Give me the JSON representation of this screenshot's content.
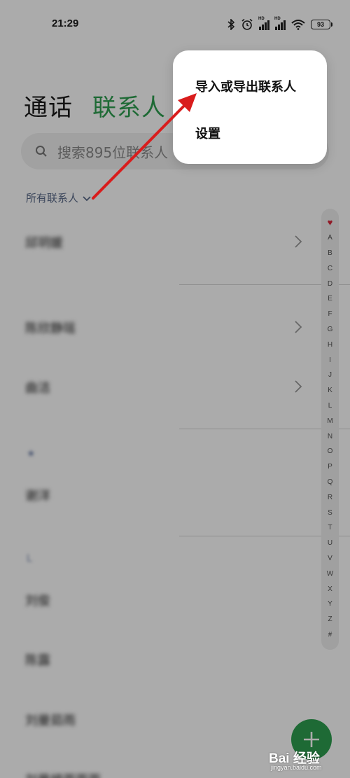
{
  "status_bar": {
    "time": "21:29",
    "icons": [
      "bluetooth-icon",
      "alarm-icon",
      "signal-hd-icon",
      "signal-hd-icon",
      "wifi-icon"
    ],
    "battery": "93"
  },
  "header": {
    "tab_calls": "通话",
    "tab_contacts": "联系人",
    "active_tab_color": "#2e9e4f"
  },
  "search": {
    "placeholder": "搜索895位联系人"
  },
  "group_label": "所有联系人",
  "contacts": {
    "rows": [
      "邱玥媛",
      "陈欣静瑶",
      "曲洁",
      "谢洋",
      "刘俊",
      "陈露",
      "刘曼茹雨",
      "刘曼婷雨雨雨"
    ],
    "sections": [
      "★",
      "L"
    ]
  },
  "index_bar": {
    "favorite_symbol": "♥",
    "letters": [
      "A",
      "B",
      "C",
      "D",
      "E",
      "F",
      "G",
      "H",
      "I",
      "J",
      "K",
      "L",
      "M",
      "N",
      "O",
      "P",
      "Q",
      "R",
      "S",
      "T",
      "U",
      "V",
      "W",
      "X",
      "Y",
      "Z",
      "#"
    ]
  },
  "menu": {
    "import_export": "导入或导出联系人",
    "settings": "设置"
  },
  "fab": {
    "icon": "plus-icon",
    "color": "#2e9e4f"
  },
  "annotation": {
    "arrow_color": "#d91c1c"
  },
  "watermark": {
    "brand": "Bai 经验",
    "url": "jingyan.baidu.com"
  }
}
